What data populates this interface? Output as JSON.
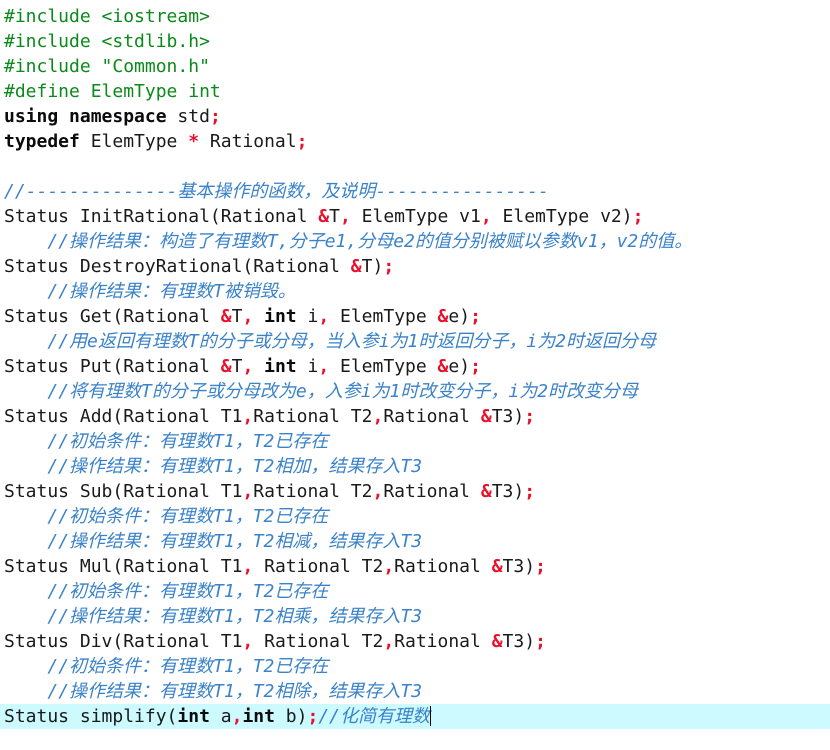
{
  "colors": {
    "preprocessor": "#0a8a1a",
    "comment": "#3a82c9",
    "keyword": "#0b0b0b",
    "operator": "#e8102a",
    "text": "#1a1a1a",
    "current_line": "#ccfaff"
  },
  "lines": [
    [
      [
        "pp",
        "#include <iostream>"
      ]
    ],
    [
      [
        "pp",
        "#include <stdlib.h>"
      ]
    ],
    [
      [
        "pp",
        "#include \"Common.h\""
      ]
    ],
    [
      [
        "pp",
        "#define ElemType int"
      ]
    ],
    [
      [
        "kw",
        "using"
      ],
      [
        "tx",
        " "
      ],
      [
        "kw",
        "namespace"
      ],
      [
        "tx",
        " std"
      ],
      [
        "op",
        ";"
      ]
    ],
    [
      [
        "kw",
        "typedef"
      ],
      [
        "tx",
        " ElemType "
      ],
      [
        "op",
        "*"
      ],
      [
        "tx",
        " Rational"
      ],
      [
        "op",
        ";"
      ]
    ],
    [],
    [
      [
        "cm",
        "//--------------基本操作的函数，及说明----------------"
      ]
    ],
    [
      [
        "tx",
        "Status InitRational(Rational "
      ],
      [
        "op",
        "&"
      ],
      [
        "tx",
        "T"
      ],
      [
        "op",
        ","
      ],
      [
        "tx",
        " ElemType v1"
      ],
      [
        "op",
        ","
      ],
      [
        "tx",
        " ElemType v2)"
      ],
      [
        "op",
        ";"
      ]
    ],
    [
      [
        "tx",
        "    "
      ],
      [
        "cm",
        "//操作结果：构造了有理数T,分子e1,分母e2的值分别被赋以参数v1，v2的值。"
      ]
    ],
    [
      [
        "tx",
        "Status DestroyRational(Rational "
      ],
      [
        "op",
        "&"
      ],
      [
        "tx",
        "T)"
      ],
      [
        "op",
        ";"
      ]
    ],
    [
      [
        "tx",
        "    "
      ],
      [
        "cm",
        "//操作结果：有理数T被销毁。"
      ]
    ],
    [
      [
        "tx",
        "Status Get(Rational "
      ],
      [
        "op",
        "&"
      ],
      [
        "tx",
        "T"
      ],
      [
        "op",
        ","
      ],
      [
        "tx",
        " "
      ],
      [
        "kw",
        "int"
      ],
      [
        "tx",
        " i"
      ],
      [
        "op",
        ","
      ],
      [
        "tx",
        " ElemType "
      ],
      [
        "op",
        "&"
      ],
      [
        "tx",
        "e)"
      ],
      [
        "op",
        ";"
      ]
    ],
    [
      [
        "tx",
        "    "
      ],
      [
        "cm",
        "//用e返回有理数T的分子或分母，当入参i为1时返回分子，i为2时返回分母"
      ]
    ],
    [
      [
        "tx",
        "Status Put(Rational "
      ],
      [
        "op",
        "&"
      ],
      [
        "tx",
        "T"
      ],
      [
        "op",
        ","
      ],
      [
        "tx",
        " "
      ],
      [
        "kw",
        "int"
      ],
      [
        "tx",
        " i"
      ],
      [
        "op",
        ","
      ],
      [
        "tx",
        " ElemType "
      ],
      [
        "op",
        "&"
      ],
      [
        "tx",
        "e)"
      ],
      [
        "op",
        ";"
      ]
    ],
    [
      [
        "tx",
        "    "
      ],
      [
        "cm",
        "//将有理数T的分子或分母改为e，入参i为1时改变分子，i为2时改变分母"
      ]
    ],
    [
      [
        "tx",
        "Status Add(Rational T1"
      ],
      [
        "op",
        ","
      ],
      [
        "tx",
        "Rational T2"
      ],
      [
        "op",
        ","
      ],
      [
        "tx",
        "Rational "
      ],
      [
        "op",
        "&"
      ],
      [
        "tx",
        "T3)"
      ],
      [
        "op",
        ";"
      ]
    ],
    [
      [
        "tx",
        "    "
      ],
      [
        "cm",
        "//初始条件：有理数T1，T2已存在"
      ]
    ],
    [
      [
        "tx",
        "    "
      ],
      [
        "cm",
        "//操作结果：有理数T1，T2相加，结果存入T3"
      ]
    ],
    [
      [
        "tx",
        "Status Sub(Rational T1"
      ],
      [
        "op",
        ","
      ],
      [
        "tx",
        "Rational T2"
      ],
      [
        "op",
        ","
      ],
      [
        "tx",
        "Rational "
      ],
      [
        "op",
        "&"
      ],
      [
        "tx",
        "T3)"
      ],
      [
        "op",
        ";"
      ]
    ],
    [
      [
        "tx",
        "    "
      ],
      [
        "cm",
        "//初始条件：有理数T1，T2已存在"
      ]
    ],
    [
      [
        "tx",
        "    "
      ],
      [
        "cm",
        "//操作结果：有理数T1，T2相减，结果存入T3"
      ]
    ],
    [
      [
        "tx",
        "Status Mul(Rational T1"
      ],
      [
        "op",
        ","
      ],
      [
        "tx",
        " Rational T2"
      ],
      [
        "op",
        ","
      ],
      [
        "tx",
        "Rational "
      ],
      [
        "op",
        "&"
      ],
      [
        "tx",
        "T3)"
      ],
      [
        "op",
        ";"
      ]
    ],
    [
      [
        "tx",
        "    "
      ],
      [
        "cm",
        "//初始条件：有理数T1，T2已存在"
      ]
    ],
    [
      [
        "tx",
        "    "
      ],
      [
        "cm",
        "//操作结果：有理数T1，T2相乘，结果存入T3"
      ]
    ],
    [
      [
        "tx",
        "Status Div(Rational T1"
      ],
      [
        "op",
        ","
      ],
      [
        "tx",
        " Rational T2"
      ],
      [
        "op",
        ","
      ],
      [
        "tx",
        "Rational "
      ],
      [
        "op",
        "&"
      ],
      [
        "tx",
        "T3)"
      ],
      [
        "op",
        ";"
      ]
    ],
    [
      [
        "tx",
        "    "
      ],
      [
        "cm",
        "//初始条件：有理数T1，T2已存在"
      ]
    ],
    [
      [
        "tx",
        "    "
      ],
      [
        "cm",
        "//操作结果：有理数T1，T2相除，结果存入T3"
      ]
    ],
    [
      [
        "tx",
        "Status simplify("
      ],
      [
        "kw",
        "int"
      ],
      [
        "tx",
        " a"
      ],
      [
        "op",
        ","
      ],
      [
        "kw",
        "int"
      ],
      [
        "tx",
        " b)"
      ],
      [
        "op",
        ";"
      ],
      [
        "cm",
        "//化简有理数"
      ]
    ]
  ],
  "current_line_index": 28
}
